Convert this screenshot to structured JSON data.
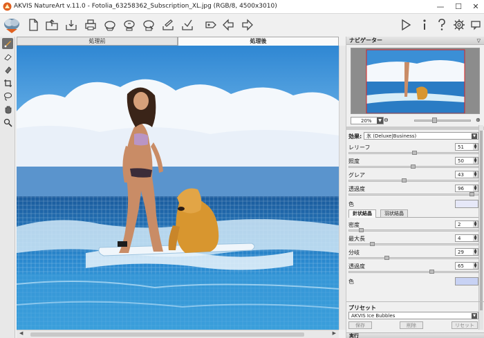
{
  "titlebar": {
    "title": "AKVIS NatureArt v.11.0 - Fotolia_63258362_Subscription_XL.jpg (RGB/8, 4500x3010)",
    "minimize": "—",
    "maximize": "☐",
    "close": "✕"
  },
  "tabs": {
    "before": "処理前",
    "after": "処理後"
  },
  "navigator": {
    "title": "ナビゲーター",
    "zoom": "20%"
  },
  "settings": {
    "effect_label": "効果:",
    "effect_value": "氷 (Deluxe|Business)",
    "params": [
      {
        "label": "レリーフ",
        "value": "51",
        "fraction": 0.51
      },
      {
        "label": "照度",
        "value": "50",
        "fraction": 0.5
      },
      {
        "label": "グレア",
        "value": "43",
        "fraction": 0.43
      },
      {
        "label": "透過度",
        "value": "96",
        "fraction": 0.96
      }
    ],
    "color_label": "色",
    "color_value": "#e6e8f8",
    "subtabs": {
      "needle": "針状結晶",
      "feather": "羽状結晶"
    },
    "needle_params": [
      {
        "label": "密度",
        "value": "2",
        "fraction": 0.1
      },
      {
        "label": "最大長",
        "value": "4",
        "fraction": 0.18
      },
      {
        "label": "分岐",
        "value": "29",
        "fraction": 0.29
      },
      {
        "label": "透過度",
        "value": "65",
        "fraction": 0.65
      }
    ],
    "needle_color_label": "色",
    "needle_color_value": "#c8d2f4"
  },
  "preset": {
    "title": "プリセット",
    "value": "AKVIS Ice Bubbles",
    "save": "保存",
    "delete": "削除",
    "reset": "リセット"
  },
  "bottom_panel": {
    "title": "実行"
  },
  "colors": {
    "accent_tool": "#e8a23a",
    "sky": "#3a8fd4",
    "sea": "#1e6fae"
  }
}
